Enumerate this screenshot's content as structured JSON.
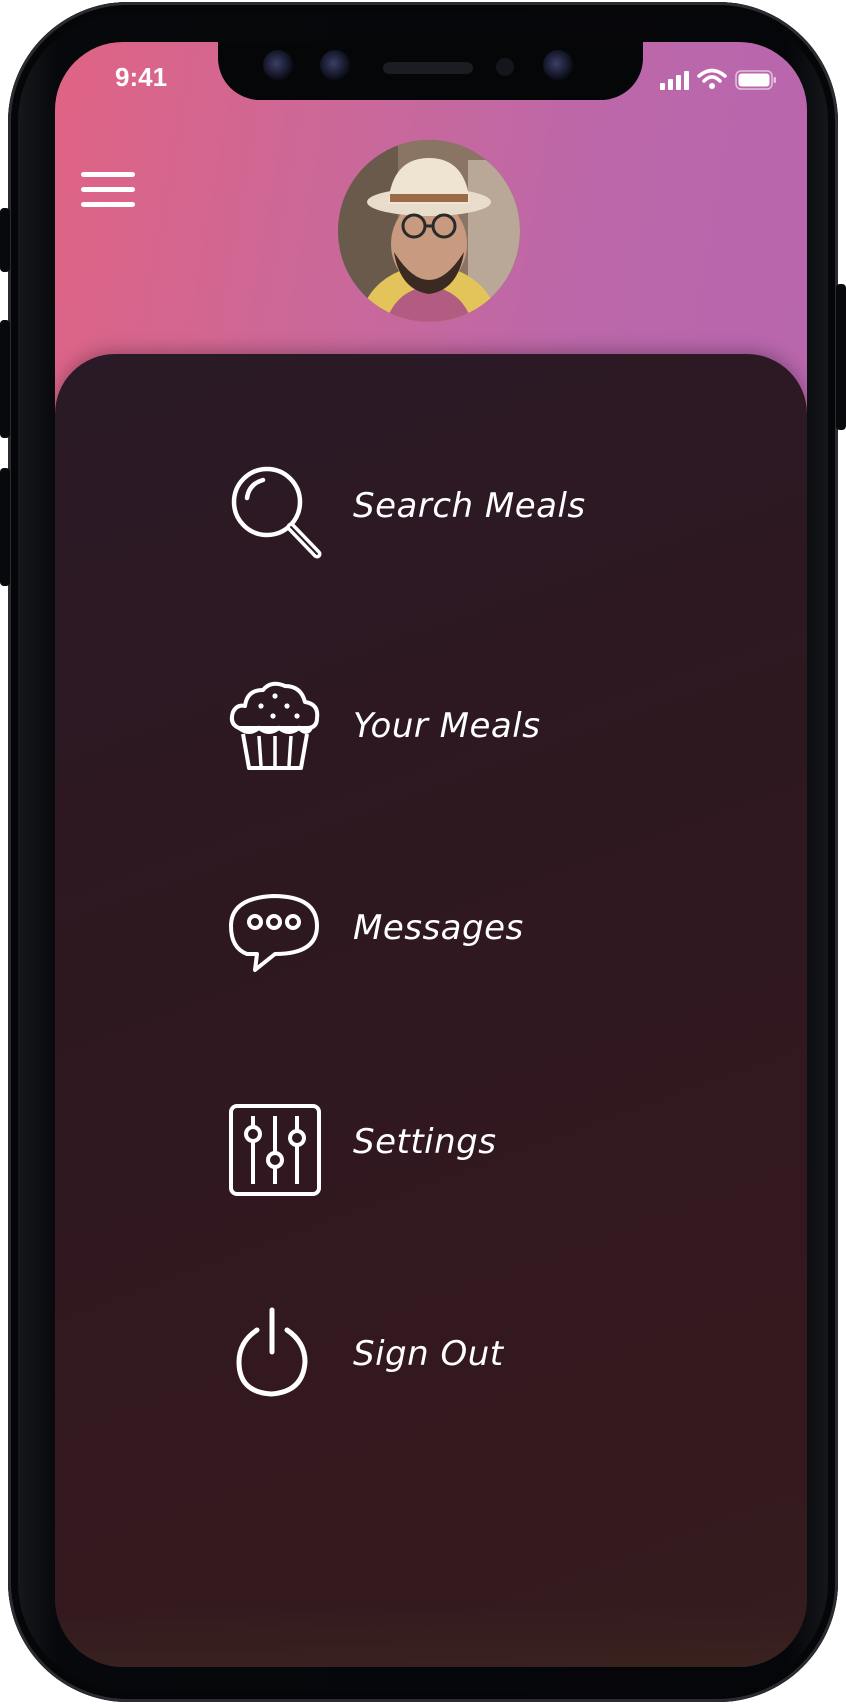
{
  "status_bar": {
    "time": "9:41"
  },
  "menu": {
    "items": [
      {
        "label": "Search Meals",
        "icon": "search-icon"
      },
      {
        "label": "Your Meals",
        "icon": "cupcake-icon"
      },
      {
        "label": "Messages",
        "icon": "chat-bubble-icon"
      },
      {
        "label": "Settings",
        "icon": "sliders-icon"
      },
      {
        "label": "Sign Out",
        "icon": "power-icon"
      }
    ]
  },
  "colors": {
    "header_gradient_start": "#e06384",
    "header_gradient_end": "#b866ae",
    "panel_background": "#2e1820",
    "text": "#ffffff"
  }
}
